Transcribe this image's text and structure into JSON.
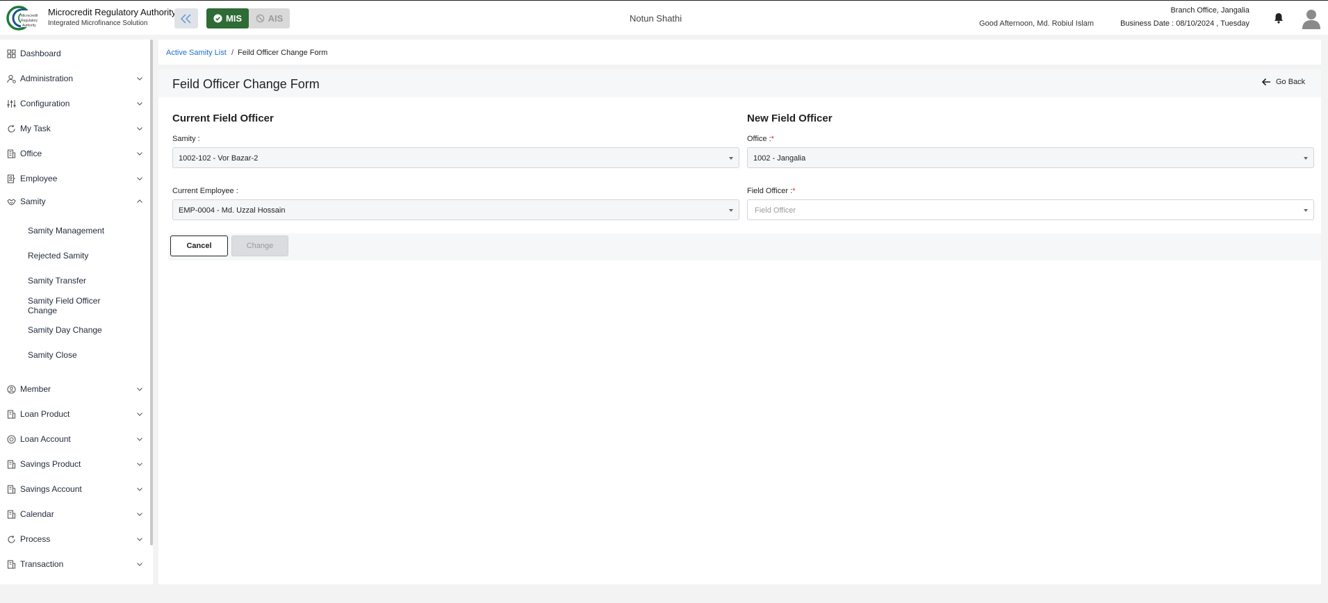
{
  "header": {
    "org_name": "Microcredit Regulatory Authority",
    "org_sub": "Integrated Microfinance Solution",
    "logo_text": "Microcredit Regulatory Authority",
    "mode_active": "MIS",
    "mode_inactive": "AIS",
    "center_title": "Notun Shathi",
    "greeting": "Good Afternoon, Md. Robiul Islam",
    "branch": "Branch Office, Jangalia",
    "business_date": "Business Date : 08/10/2024 , Tuesday",
    "accent_color": "#2e6b35"
  },
  "sidebar": {
    "items": [
      {
        "label": "Dashboard",
        "icon": "grid-icon"
      },
      {
        "label": "Administration",
        "icon": "user-gear-icon"
      },
      {
        "label": "Configuration",
        "icon": "sliders-icon"
      },
      {
        "label": "My Task",
        "icon": "refresh-icon"
      },
      {
        "label": "Office",
        "icon": "building-icon"
      },
      {
        "label": "Employee",
        "icon": "badge-icon"
      },
      {
        "label": "Samity",
        "icon": "handshake-icon"
      },
      {
        "label": "Member",
        "icon": "users-icon"
      },
      {
        "label": "Loan Product",
        "icon": "document-icon"
      },
      {
        "label": "Loan Account",
        "icon": "coins-icon"
      },
      {
        "label": "Savings Product",
        "icon": "document-icon"
      },
      {
        "label": "Savings Account",
        "icon": "document-icon"
      },
      {
        "label": "Calendar",
        "icon": "calendar-icon"
      },
      {
        "label": "Process",
        "icon": "refresh-icon"
      },
      {
        "label": "Transaction",
        "icon": "document-icon"
      }
    ],
    "samity_sub": [
      "Samity Management",
      "Rejected Samity",
      "Samity Transfer",
      "Samity Field Officer",
      "Change",
      "Samity Day Change",
      "Samity Close"
    ]
  },
  "breadcrumb": {
    "link": "Active Samity List",
    "separator": "/",
    "current": "Feild Officer Change Form"
  },
  "form": {
    "title": "Feild Officer Change Form",
    "go_back": "Go Back",
    "current_section": "Current Field Officer",
    "new_section": "New Field Officer",
    "samity_label": "Samity :",
    "samity_value": "1002-102 - Vor Bazar-2",
    "current_employee_label": "Current Employee :",
    "current_employee_value": "EMP-0004 - Md. Uzzal Hossain",
    "office_label": "Office :",
    "office_value": "1002 - Jangalia",
    "field_officer_label": "Field Officer :",
    "field_officer_placeholder": "Field Officer",
    "required_mark": "*",
    "cancel": "Cancel",
    "change": "Change"
  }
}
